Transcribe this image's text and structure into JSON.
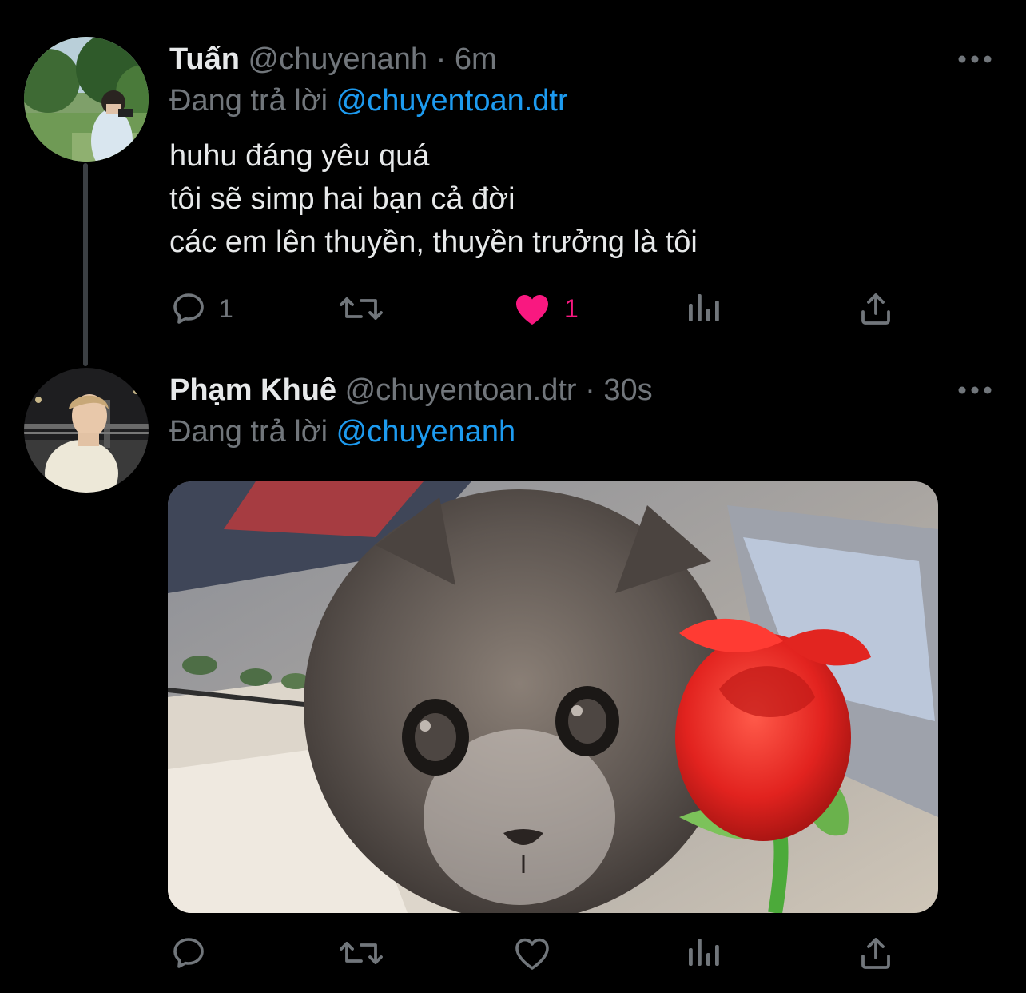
{
  "tweets": [
    {
      "name": "Tuấn",
      "handle": "@chuyenanh",
      "separator": "·",
      "time": "6m",
      "reply_prefix": "Đang trả lời",
      "reply_to": "@chuyentoan.dtr",
      "text_lines": [
        "huhu đáng yêu quá",
        "tôi sẽ simp hai bạn cả đời",
        "các em lên thuyền, thuyền trưởng là tôi"
      ],
      "reply_count": "1",
      "like_count": "1",
      "liked": true
    },
    {
      "name": "Phạm Khuê",
      "handle": "@chuyentoan.dtr",
      "separator": "·",
      "time": "30s",
      "reply_prefix": "Đang trả lời",
      "reply_to": "@chuyenanh",
      "liked": false
    }
  ],
  "colors": {
    "background": "#000000",
    "text": "#e7e9ea",
    "muted": "#71767b",
    "accent": "#1d9bf0",
    "like": "#f91880"
  },
  "icons": [
    "reply-icon",
    "retweet-icon",
    "like-icon",
    "views-icon",
    "share-icon",
    "more-icon"
  ]
}
